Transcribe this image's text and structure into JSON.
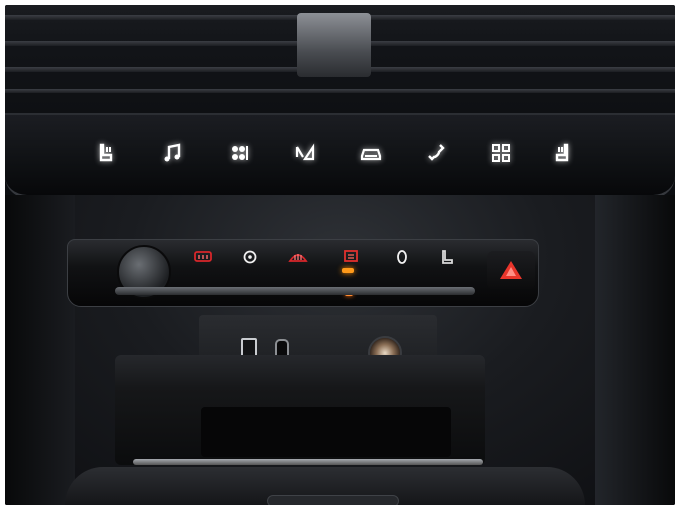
{
  "scene": {
    "touch_bar_icons": [
      "seat-heat-left-icon",
      "music-note-icon",
      "fan-icon",
      "navigation-icon",
      "car-icon",
      "phone-icon",
      "apps-grid-icon",
      "seat-heat-right-icon"
    ],
    "climate_icons": [
      "volume-knob",
      "rear-defrost-icon",
      "steering-heat-icon",
      "front-defrost-icon",
      "windshield-icon",
      "recirculation-icon",
      "seat-icon",
      "hazard-icon"
    ],
    "ports": [
      "usb-a-port",
      "usb-c-port",
      "power-socket"
    ],
    "colors": {
      "icon_glow": "#ffffff",
      "led_amber": "#ff9a1a",
      "hazard_red": "#e8352b",
      "climate_red": "#d8262a"
    }
  }
}
